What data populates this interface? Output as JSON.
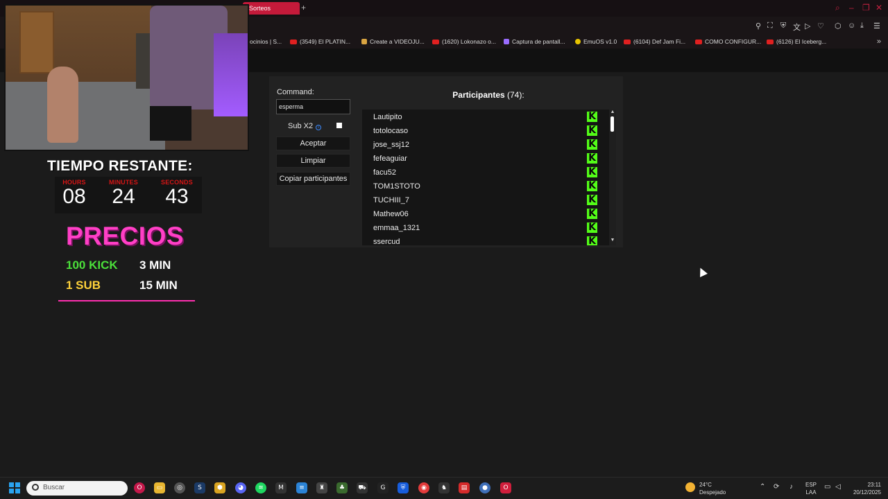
{
  "browser": {
    "active_tab": "Sorteos",
    "new_tab_label": "+",
    "bookmarks": [
      {
        "label": "ocinios | S...",
        "kind": "other"
      },
      {
        "label": "(3549) El PLATIN...",
        "kind": "youtube"
      },
      {
        "label": "Create a VIDEOJU...",
        "kind": "other"
      },
      {
        "label": "(1620) Lokonazo o...",
        "kind": "youtube"
      },
      {
        "label": "Captura de pantall...",
        "kind": "other"
      },
      {
        "label": "EmuOS v1.0",
        "kind": "other"
      },
      {
        "label": "(6104) Def Jam Fi...",
        "kind": "youtube"
      },
      {
        "label": "COMO CONFIGUR...",
        "kind": "youtube"
      },
      {
        "label": "(6126) El Iceberg...",
        "kind": "youtube"
      }
    ]
  },
  "overlay": {
    "timer_title": "TIEMPO RESTANTE:",
    "timer": [
      {
        "label": "HOURS",
        "value": "08"
      },
      {
        "label": "MINUTES",
        "value": "24"
      },
      {
        "label": "SECONDS",
        "value": "43"
      }
    ],
    "prices_title": "PRECIOS",
    "prices": [
      {
        "item": "100 KICK",
        "time": "3 MIN",
        "item_color": "#4be03a"
      },
      {
        "item": "1 SUB",
        "time": "15 MIN",
        "item_color": "#ffd23a"
      }
    ]
  },
  "raffle": {
    "command_label": "Command:",
    "command_value": "esperma",
    "sub_label": "Sub X2",
    "sub_checked": false,
    "buttons": {
      "accept": "Aceptar",
      "clear": "Limpiar",
      "copy": "Copiar participantes"
    },
    "participants_title": "Participantes",
    "participants_count": "(74):",
    "participants": [
      "Lautipito",
      "totolocaso",
      "jose_ssj12",
      "fefeaguiar",
      "facu52",
      "TOM1STOTO",
      "TUCHIII_7",
      "Mathew06",
      "emmaa_1321",
      "ssercud"
    ],
    "platform_icon": "kick-icon",
    "platform_color": "#53fc18"
  },
  "taskbar": {
    "search_placeholder": "Buscar",
    "weather_temp": "24°C",
    "weather_desc": "Despejado",
    "lang_top": "ESP",
    "lang_bottom": "LAA",
    "time": "23:11",
    "date": "20/12/2025"
  }
}
